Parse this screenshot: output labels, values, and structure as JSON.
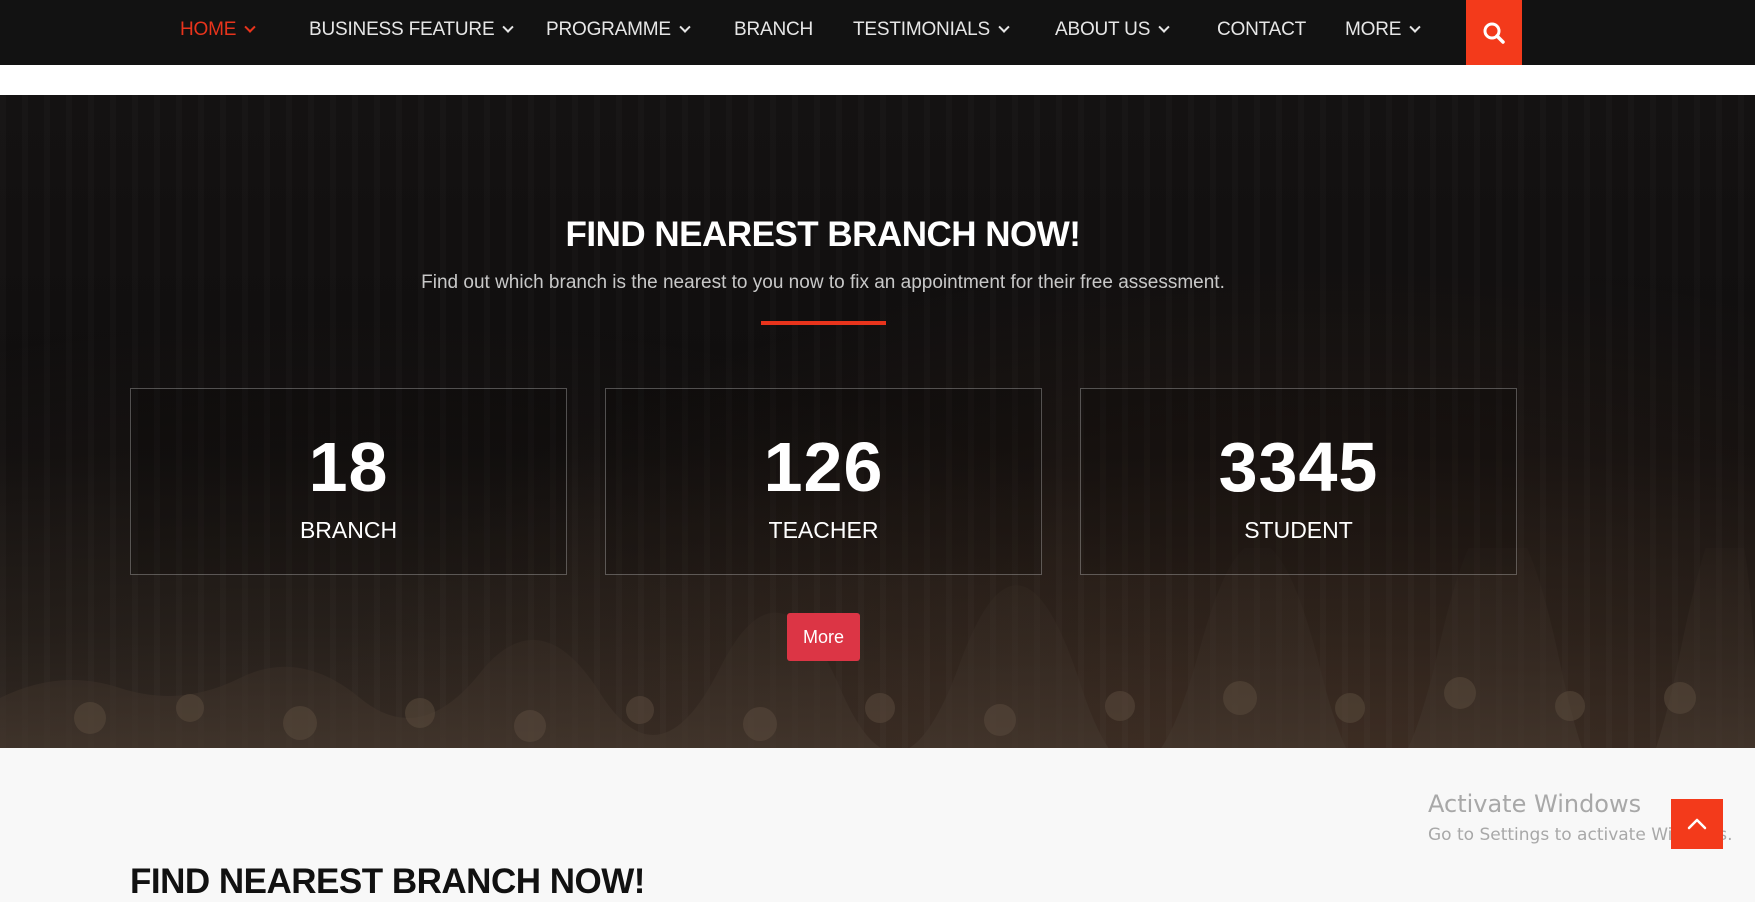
{
  "nav": {
    "items": [
      {
        "label": "HOME",
        "dropdown": true,
        "active": true
      },
      {
        "label": "BUSINESS FEATURE",
        "dropdown": true
      },
      {
        "label": "PROGRAMME",
        "dropdown": true
      },
      {
        "label": "BRANCH",
        "dropdown": false
      },
      {
        "label": "TESTIMONIALS",
        "dropdown": true
      },
      {
        "label": "ABOUT US",
        "dropdown": true
      },
      {
        "label": "CONTACT",
        "dropdown": false
      },
      {
        "label": "MORE",
        "dropdown": true
      }
    ],
    "search_icon": "search-icon"
  },
  "hero": {
    "title": "FIND NEAREST BRANCH NOW!",
    "subtitle": "Find out which branch is the nearest to you now to fix an appointment for their free assessment.",
    "stats": [
      {
        "value": "18",
        "label": "BRANCH"
      },
      {
        "value": "126",
        "label": "TEACHER"
      },
      {
        "value": "3345",
        "label": "STUDENT"
      }
    ],
    "more_label": "More"
  },
  "below": {
    "title": "FIND NEAREST BRANCH NOW!"
  },
  "watermark": {
    "line1": "Activate Windows",
    "line2": "Go to Settings to activate Windows."
  },
  "colors": {
    "accent": "#f33a1b",
    "active_nav": "#e8341c",
    "nav_bg": "#121212",
    "button_red": "#dc3545"
  },
  "scroll_top_icon": "chevron-up-icon"
}
